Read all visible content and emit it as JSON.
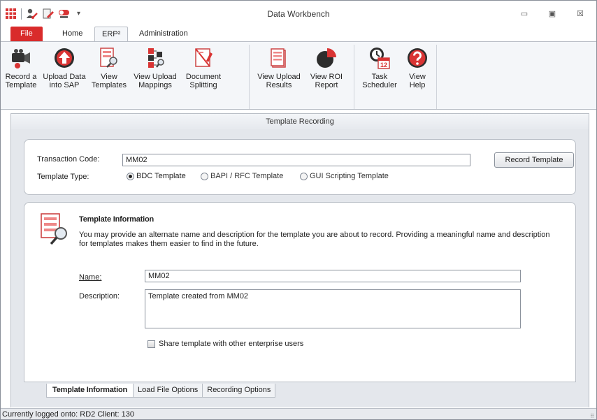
{
  "window": {
    "title": "Data Workbench"
  },
  "quick_access": {
    "icons": [
      "app-grid-icon",
      "user-key-icon",
      "edit-doc-icon",
      "toggle-icon"
    ],
    "dropdown": "▾"
  },
  "window_controls": {
    "minimize": "▭",
    "maximize": "▣",
    "close": "☒"
  },
  "ribbon_tabs": [
    {
      "label": "File"
    },
    {
      "label": "Home"
    },
    {
      "label": "ERP²"
    },
    {
      "label": "Administration"
    }
  ],
  "ribbon": {
    "record_template": "Record a\nTemplate",
    "upload_data": "Upload Data\ninto SAP",
    "view_templates": "View\nTemplates",
    "view_upload_mappings": "View Upload\nMappings",
    "document_splitting": "Document\nSplitting",
    "view_upload_results": "View Upload\nResults",
    "view_roi_report": "View ROI\nReport",
    "task_scheduler": "Task\nScheduler",
    "view_help": "View\nHelp",
    "scheduler_badge": "12"
  },
  "section_title": "Template Recording",
  "recording": {
    "transaction_label": "Transaction Code:",
    "transaction_value": "MM02",
    "record_button": "Record Template",
    "type_label": "Template Type:",
    "types": [
      {
        "label": "BDC Template",
        "selected": true
      },
      {
        "label": "BAPI / RFC Template",
        "selected": false
      },
      {
        "label": "GUI Scripting Template",
        "selected": false
      }
    ]
  },
  "info": {
    "title": "Template Information",
    "description": "You may provide an alternate name and description for the template you are about to record. Providing a meaningful name and description for templates makes them easier to find in the future.",
    "name_label": "Name:",
    "name_value": "MM02",
    "desc_label": "Description:",
    "desc_value": "Template created from MM02",
    "share_label": "Share template with other enterprise users",
    "share_checked": false
  },
  "bottom_tabs": [
    {
      "label": "Template Information",
      "active": true
    },
    {
      "label": "Load File Options",
      "active": false
    },
    {
      "label": "Recording Options",
      "active": false
    }
  ],
  "status": {
    "text": "Currently logged onto: RD2 Client: 130"
  },
  "colors": {
    "file_tab": "#d92b2b",
    "accent_red": "#d93434",
    "panel_bg": "#e4e7ec"
  }
}
